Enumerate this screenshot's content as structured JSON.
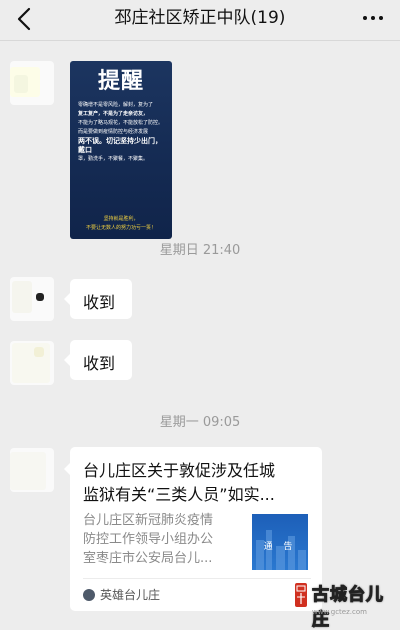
{
  "header": {
    "title": "邳庄社区矫正中队(19)",
    "back_icon": "chevron-left-icon",
    "more_icon": "more-dots-icon"
  },
  "messages": {
    "poster": {
      "title": "提醒",
      "lines": [
        {
          "text": "零确增不是零风险，解封，复为了",
          "style": "normal"
        },
        {
          "text": "复工复产，不是为了走亲访友，",
          "style": "hl"
        },
        {
          "text": "不能为了略马观花，不能放松了防控。",
          "style": "normal"
        },
        {
          "text": "而是要做到疫情防控与经济发展",
          "style": "normal"
        },
        {
          "text": "两不误。切记坚持少出门，戴口",
          "style": "big"
        },
        {
          "text": "罩，勤洗手，不聚餐，不聚集。",
          "style": "normal"
        }
      ],
      "footer": [
        "坚持就是胜利，",
        "不要让无数人的努力功亏一篑！"
      ]
    },
    "timestamp_1": "星期日 21:40",
    "reply_1": "收到",
    "reply_2": "收到",
    "timestamp_2": "星期一 09:05",
    "article": {
      "title_lines": [
        "台儿庄区关于敦促涉及任城",
        "监狱有关“三类人员”如实..."
      ],
      "desc_lines": [
        "台儿庄区新冠肺炎疫情",
        "防控工作领导小组办公",
        "室枣庄市公安局台儿..."
      ],
      "thumb_text": "通 告",
      "source": "英雄台儿庄",
      "source_icon": "account-avatar-icon"
    }
  },
  "watermark": {
    "text": "古城台儿庄",
    "url": "www.gctez.com"
  },
  "colors": {
    "background": "#ededed",
    "bubble": "#ffffff",
    "poster_bg": "#142a52",
    "thumb_bg": "#2a78d0"
  }
}
